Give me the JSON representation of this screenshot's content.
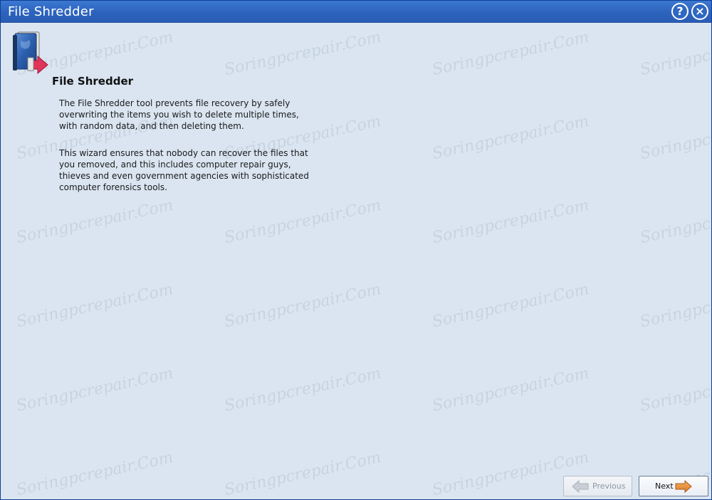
{
  "window": {
    "title": "File Shredder"
  },
  "titlebar": {
    "help_symbol": "?",
    "close_symbol": "×",
    "help_icon": "help-circle-icon",
    "close_icon": "close-circle-icon"
  },
  "header": {
    "icon": "book-shredder-icon",
    "title": "File Shredder"
  },
  "body": {
    "paragraph1": "The File Shredder tool prevents file recovery by safely overwriting the items you wish to delete multiple times, with random data, and then deleting them.",
    "paragraph2": "This wizard ensures that nobody can recover the files that you removed, and this includes computer repair guys, thieves and even government agencies with sophisticated computer forensics tools."
  },
  "watermark": {
    "text": "Soringpcrepair.Com"
  },
  "footer": {
    "previous_label": "Previous",
    "next_label": "Next",
    "previous_enabled": false,
    "next_enabled": true,
    "previous_icon": "arrow-left-icon",
    "next_icon": "arrow-right-icon"
  },
  "colors": {
    "titlebar": "#2d63bd",
    "background": "#dae5f1",
    "accent_arrow": "#e8943a",
    "icon_arrow": "#e0345a"
  }
}
